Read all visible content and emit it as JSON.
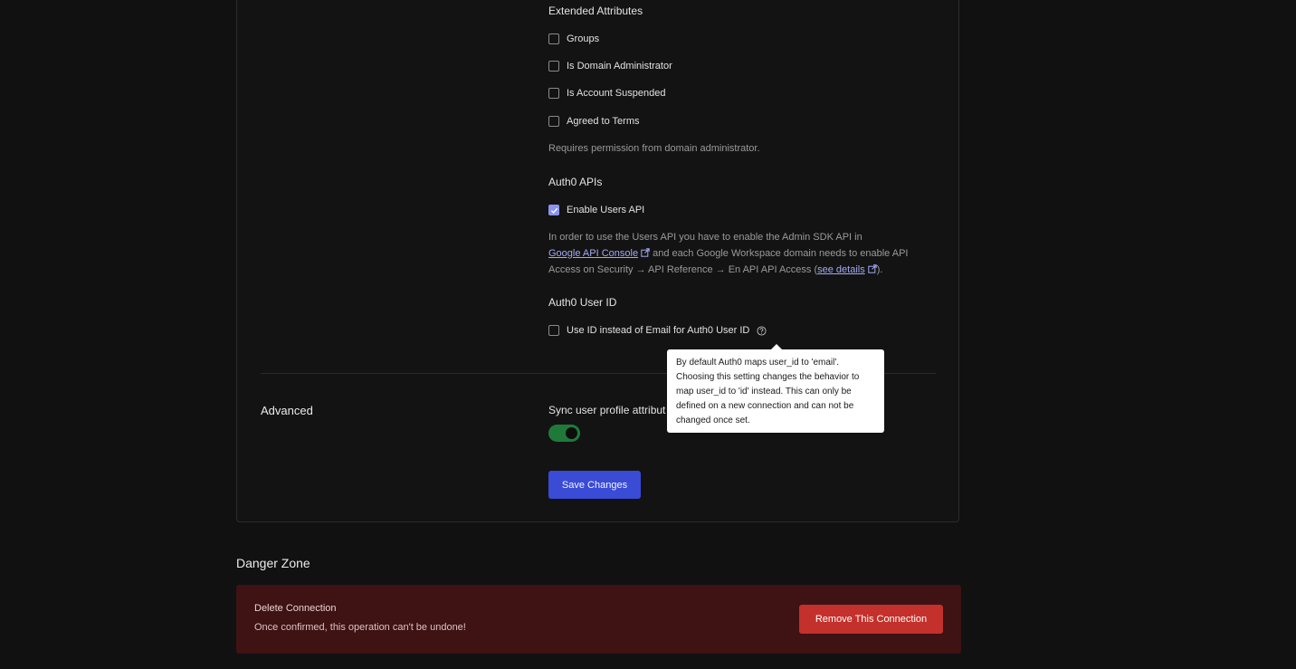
{
  "extended_attributes": {
    "heading": "Extended Attributes",
    "items": [
      {
        "label": "Groups",
        "checked": false
      },
      {
        "label": "Is Domain Administrator",
        "checked": false
      },
      {
        "label": "Is Account Suspended",
        "checked": false
      },
      {
        "label": "Agreed to Terms",
        "checked": false
      }
    ],
    "help": "Requires permission from domain administrator."
  },
  "auth0_apis": {
    "heading": "Auth0 APIs",
    "enable_users_api": {
      "label": "Enable Users API",
      "checked": true
    },
    "help_part1": "In order to use the Users API you have to enable the Admin SDK API in",
    "help_link1": "Google API Console",
    "help_part2": "and each Google Workspace domain needs to enable API",
    "help_part3": "Access on Security → API Reference → En API API Access (",
    "help_link2": "see details",
    "help_part4": ")."
  },
  "auth0_user_id": {
    "heading": "Auth0 User ID",
    "use_id": {
      "label": "Use ID instead of Email for Auth0 User ID",
      "checked": false
    },
    "tooltip": "By default Auth0 maps user_id to 'email'. Choosing this setting changes the behavior to map user_id to 'id' instead. This can only be defined on a new connection and can not be changed once set."
  },
  "advanced": {
    "title": "Advanced",
    "sync_label": "Sync user profile attribut",
    "sync_enabled": true,
    "save_label": "Save Changes"
  },
  "danger_zone": {
    "title": "Danger Zone",
    "delete_title": "Delete Connection",
    "delete_desc": "Once confirmed, this operation can't be undone!",
    "remove_label": "Remove This Connection"
  },
  "colors": {
    "accent": "#3a4bd6",
    "checkbox_checked": "#8b93ee",
    "toggle_on": "#1f7a3a",
    "danger_bg": "#3f1213",
    "danger_button": "#c4302b"
  }
}
